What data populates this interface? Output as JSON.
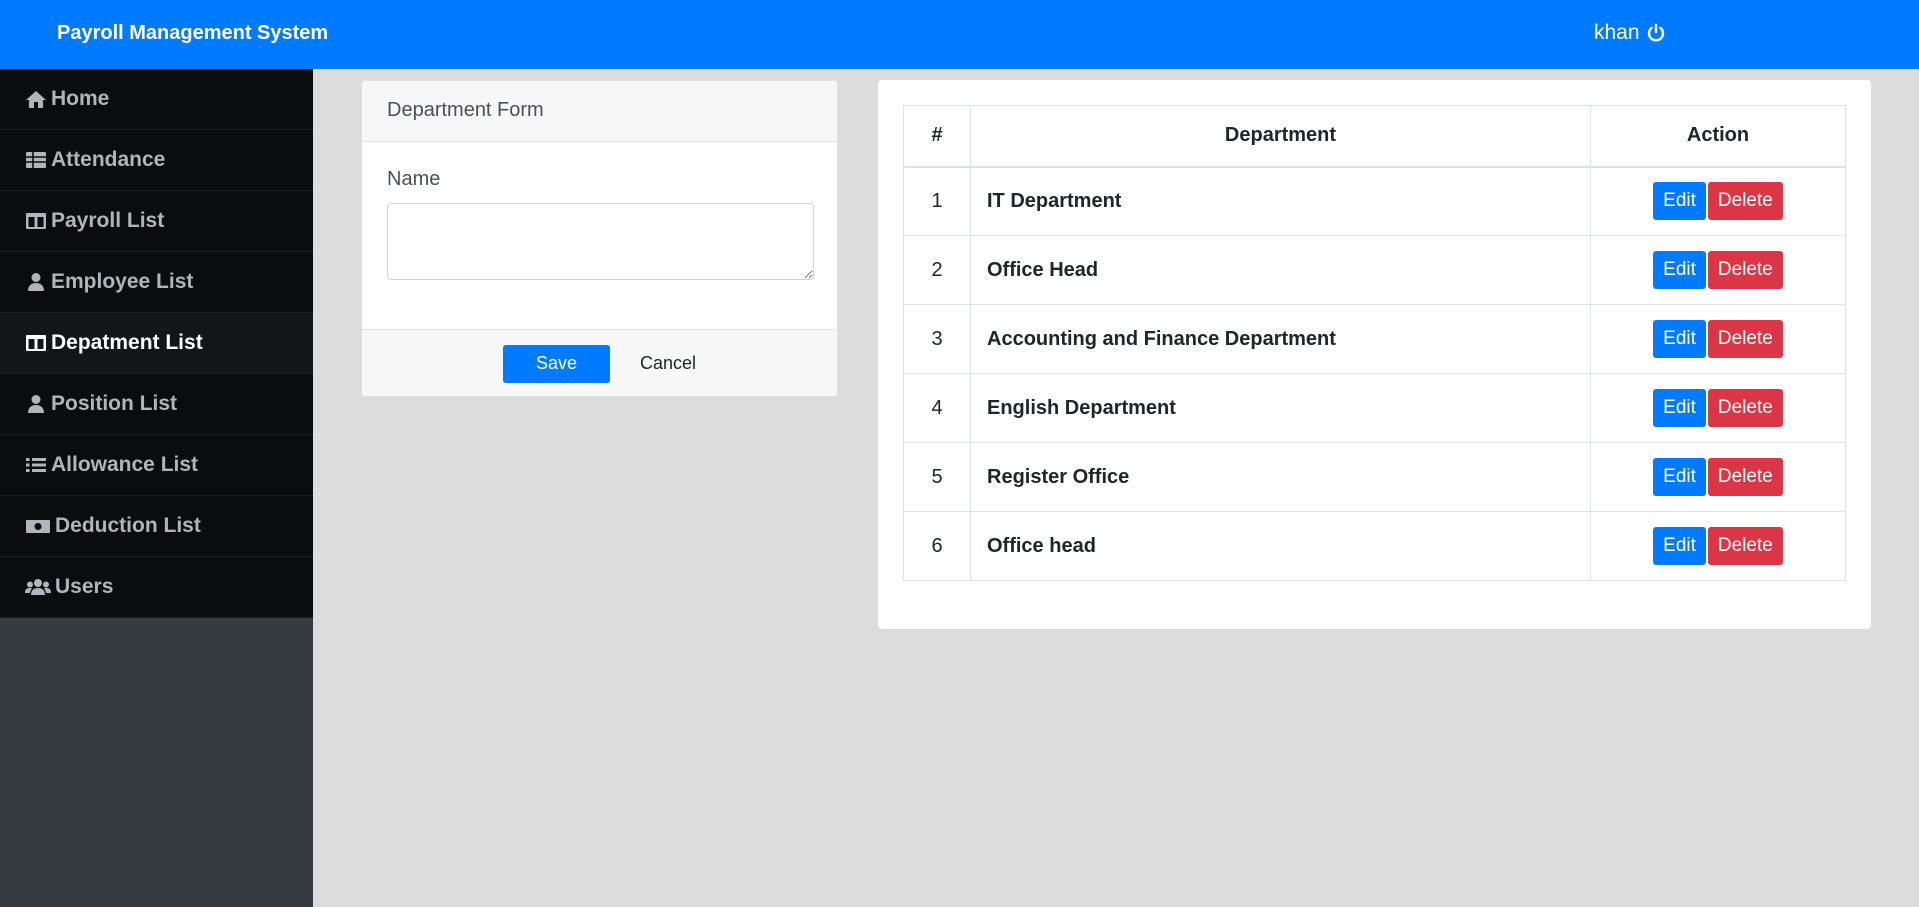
{
  "header": {
    "title": "Payroll Management System",
    "user": "khan",
    "user_icon": "power-icon"
  },
  "sidebar": {
    "items": [
      {
        "label": "Home",
        "icon": "home-icon"
      },
      {
        "label": "Attendance",
        "icon": "table-icon"
      },
      {
        "label": "Payroll List",
        "icon": "columns-icon"
      },
      {
        "label": "Employee List",
        "icon": "user-tie-icon"
      },
      {
        "label": "Depatment List",
        "icon": "columns-icon",
        "active": true
      },
      {
        "label": "Position List",
        "icon": "user-tie-icon"
      },
      {
        "label": "Allowance List",
        "icon": "list-icon"
      },
      {
        "label": "Deduction List",
        "icon": "money-bill-icon"
      },
      {
        "label": "Users",
        "icon": "users-icon"
      }
    ]
  },
  "form": {
    "title": "Department Form",
    "name_label": "Name",
    "name_value": "",
    "save_label": "Save",
    "cancel_label": "Cancel"
  },
  "table": {
    "headers": [
      "#",
      "Department",
      "Action"
    ],
    "edit_label": "Edit",
    "delete_label": "Delete",
    "rows": [
      {
        "num": "1",
        "name": "IT Department"
      },
      {
        "num": "2",
        "name": "Office Head"
      },
      {
        "num": "3",
        "name": "Accounting and Finance Department"
      },
      {
        "num": "4",
        "name": "English Department"
      },
      {
        "num": "5",
        "name": "Register Office"
      },
      {
        "num": "6",
        "name": "Office head"
      }
    ]
  },
  "colors": {
    "primary": "#007bff",
    "danger": "#dc3545",
    "sidebar": "#0b0c0d",
    "background": "#dcdcdc"
  }
}
